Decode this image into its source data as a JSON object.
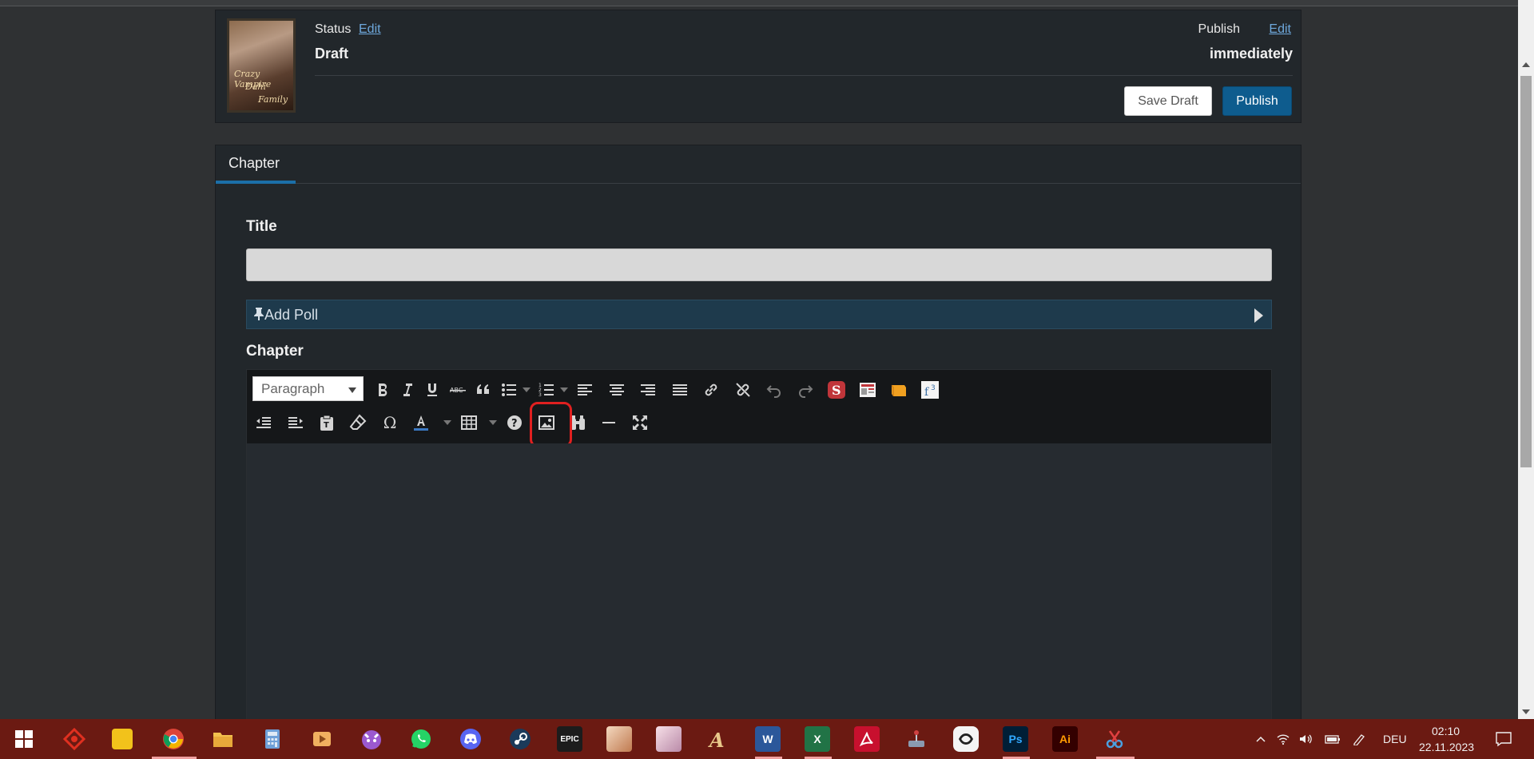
{
  "publish_box": {
    "cover_lines": [
      "Crazy Vampire",
      "Dahi",
      "Family"
    ],
    "status_label": "Status",
    "status_edit": "Edit",
    "status_value": "Draft",
    "publish_label": "Publish",
    "publish_edit": "Edit",
    "publish_value": "immediately",
    "save_draft_label": "Save Draft",
    "publish_button_label": "Publish"
  },
  "chapter_panel": {
    "tab_label": "Chapter",
    "title_label": "Title",
    "title_value": "",
    "poll_label": "Add Poll",
    "chapter_label": "Chapter",
    "format_select": "Paragraph",
    "toolbar_row1": [
      "bold-icon",
      "italic-icon",
      "underline-icon",
      "strikethrough-icon",
      "blockquote-icon",
      "bullet-list-icon",
      "numbered-list-icon",
      "align-left-icon",
      "align-center-icon",
      "align-right-icon",
      "align-justify-icon",
      "link-icon",
      "unlink-icon",
      "undo-icon",
      "redo-icon",
      "spoiler-s-icon",
      "news-icon",
      "note-icon",
      "footnote-icon"
    ],
    "toolbar_row2": [
      "outdent-icon",
      "indent-icon",
      "paste-text-icon",
      "eraser-icon",
      "omega-icon",
      "text-color-icon",
      "table-icon",
      "help-icon",
      "image-icon",
      "find-icon",
      "hr-icon",
      "fullscreen-icon"
    ]
  },
  "taskbar": {
    "icons": [
      "windows-start-icon",
      "game-icon",
      "sticky-notes-icon",
      "chrome-icon",
      "file-explorer-icon",
      "calculator-icon",
      "media-player-icon",
      "cat-app-icon",
      "whatsapp-icon",
      "discord-icon",
      "steam-icon",
      "epic-games-icon",
      "anime-game-icon-1",
      "anime-game-icon-2",
      "game-a-icon",
      "word-icon",
      "excel-icon",
      "acrobat-icon",
      "joystick-icon",
      "clip-icon",
      "photoshop-icon",
      "illustrator-icon",
      "snip-icon"
    ],
    "epic_label": "EPIC",
    "ps_label": "Ps",
    "ai_label": "Ai",
    "w_label": "W",
    "x_label": "X",
    "language": "DEU",
    "time": "02:10",
    "date": "22.11.2023"
  },
  "colors": {
    "accent": "#0e5c8e",
    "link": "#6ea8dc",
    "taskbar": "#6b1a12",
    "highlight": "#e02020"
  }
}
